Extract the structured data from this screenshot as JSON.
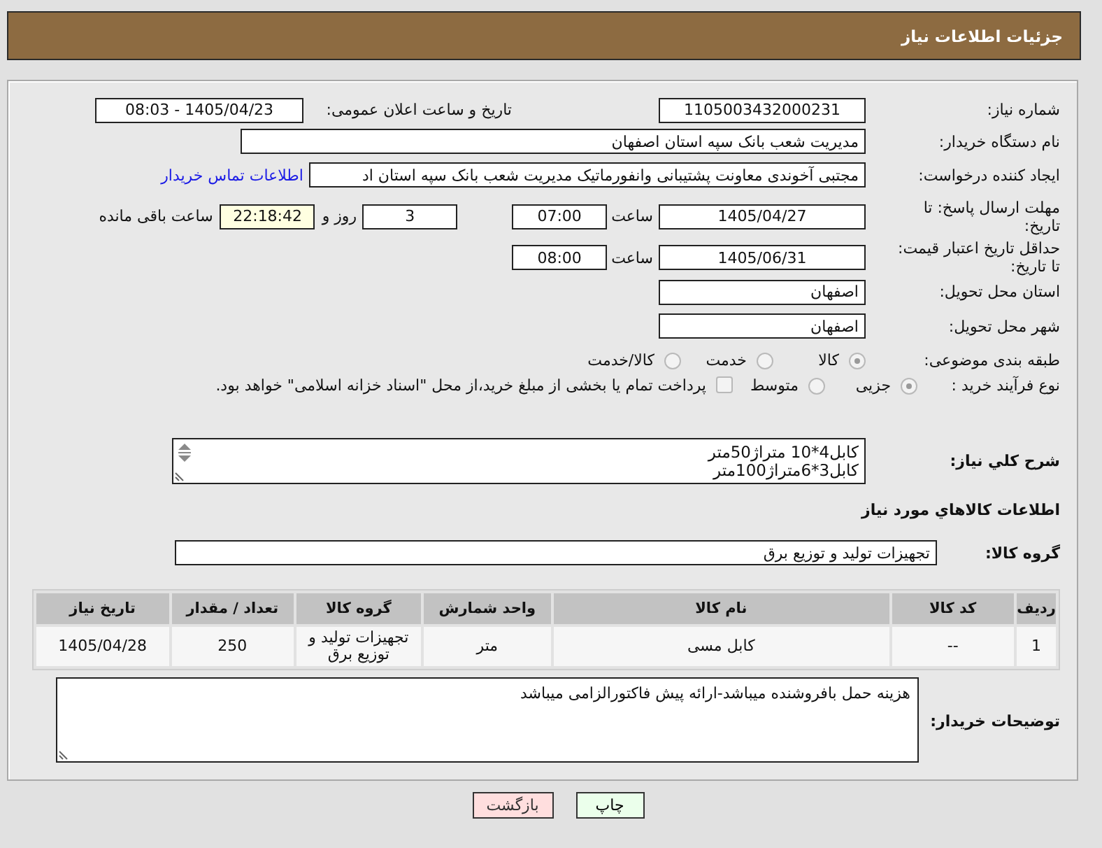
{
  "header": {
    "title": "جزئیات اطلاعات نیاز"
  },
  "form": {
    "need_number": {
      "label": "شماره نیاز:",
      "value": "1105003432000231"
    },
    "announce_datetime": {
      "label": "تاریخ و ساعت اعلان عمومی:",
      "value": "1405/04/23 - 08:03"
    },
    "buyer_org": {
      "label": "نام دستگاه خریدار:",
      "value": "مدیریت شعب بانک سپه استان اصفهان"
    },
    "requester": {
      "label": "ایجاد کننده درخواست:",
      "value": "مجتبی آخوندی معاونت پشتیبانی وانفورماتیک مدیریت شعب بانک سپه استان اد",
      "link": "اطلاعات تماس خریدار"
    },
    "reply_deadline": {
      "label": "مهلت ارسال پاسخ: تا تاریخ:",
      "date": "1405/04/27",
      "time_label": "ساعت",
      "time": "07:00",
      "days": "3",
      "days_label": "روز و",
      "remaining": "22:18:42",
      "remaining_label": "ساعت باقی مانده"
    },
    "price_validity": {
      "label": "حداقل تاریخ اعتبار قیمت: تا تاریخ:",
      "date": "1405/06/31",
      "time_label": "ساعت",
      "time": "08:00"
    },
    "delivery_province": {
      "label": "استان محل تحویل:",
      "value": "اصفهان"
    },
    "delivery_city": {
      "label": "شهر محل تحویل:",
      "value": "اصفهان"
    },
    "category": {
      "label": "طبقه بندی موضوعی:",
      "options": [
        {
          "label": "کالا",
          "selected": true
        },
        {
          "label": "خدمت",
          "selected": false
        },
        {
          "label": "کالا/خدمت",
          "selected": false
        }
      ]
    },
    "purchase_process": {
      "label": "نوع فرآیند خرید :",
      "options": [
        {
          "label": "جزیی",
          "selected": true
        },
        {
          "label": "متوسط",
          "selected": false
        }
      ],
      "treasury": {
        "label": "پرداخت تمام یا بخشی از مبلغ خرید،از محل \"اسناد خزانه اسلامی\" خواهد بود.",
        "checked": false
      }
    },
    "description": {
      "label": "شرح کلي نیاز:",
      "lines": [
        "کابل4*10 متراژ50متر",
        "کابل3*6متراژ100متر"
      ]
    }
  },
  "goods": {
    "heading": "اطلاعات کالاهاي مورد نیاز",
    "group": {
      "label": "گروه کالا:",
      "value": "تجهیزات تولید و توزیع برق"
    },
    "table": {
      "columns": [
        "ردیف",
        "کد کالا",
        "نام کالا",
        "واحد شمارش",
        "گروه کالا",
        "تعداد / مقدار",
        "تاریخ نیاز"
      ],
      "rows": [
        [
          "1",
          "--",
          "کابل مسی",
          "متر",
          "تجهیزات تولید و توزیع برق",
          "250",
          "1405/04/28"
        ]
      ]
    }
  },
  "buyer_notes": {
    "label": "توضیحات خریدار:",
    "value": "هزینه حمل بافروشنده میباشد-ارائه پیش فاکتورالزامی میباشد"
  },
  "buttons": [
    {
      "label": "چاپ",
      "kind": "print"
    },
    {
      "label": "بازگشت",
      "kind": "back"
    }
  ]
}
